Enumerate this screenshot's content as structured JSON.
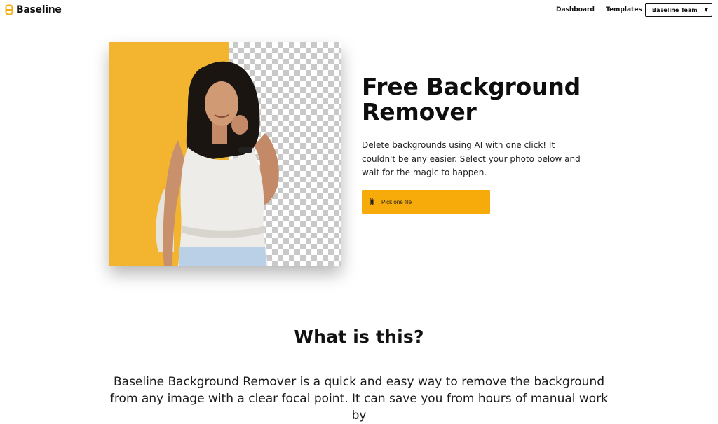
{
  "header": {
    "logo_text": "Baseline",
    "nav": {
      "dashboard": "Dashboard",
      "templates": "Templates"
    },
    "team_button": "Baseline Team"
  },
  "hero": {
    "title_line1": "Free Background",
    "title_line2": "Remover",
    "description": "Delete backgrounds using AI with one click! It couldn't be any easier. Select your photo below and wait for the magic to happen.",
    "pick_button": "Pick one file"
  },
  "about": {
    "title": "What is this?",
    "body": "Baseline Background Remover is a quick and easy way to remove the background from any image with a clear focal point. It can save you from hours of manual work by"
  },
  "colors": {
    "accent": "#f7ab0a",
    "hero_left_bg": "#f3b530",
    "text": "#111111"
  },
  "icons": {
    "logo": "baseline-logo-icon",
    "caret": "chevron-down-icon",
    "attach": "paperclip-icon"
  }
}
